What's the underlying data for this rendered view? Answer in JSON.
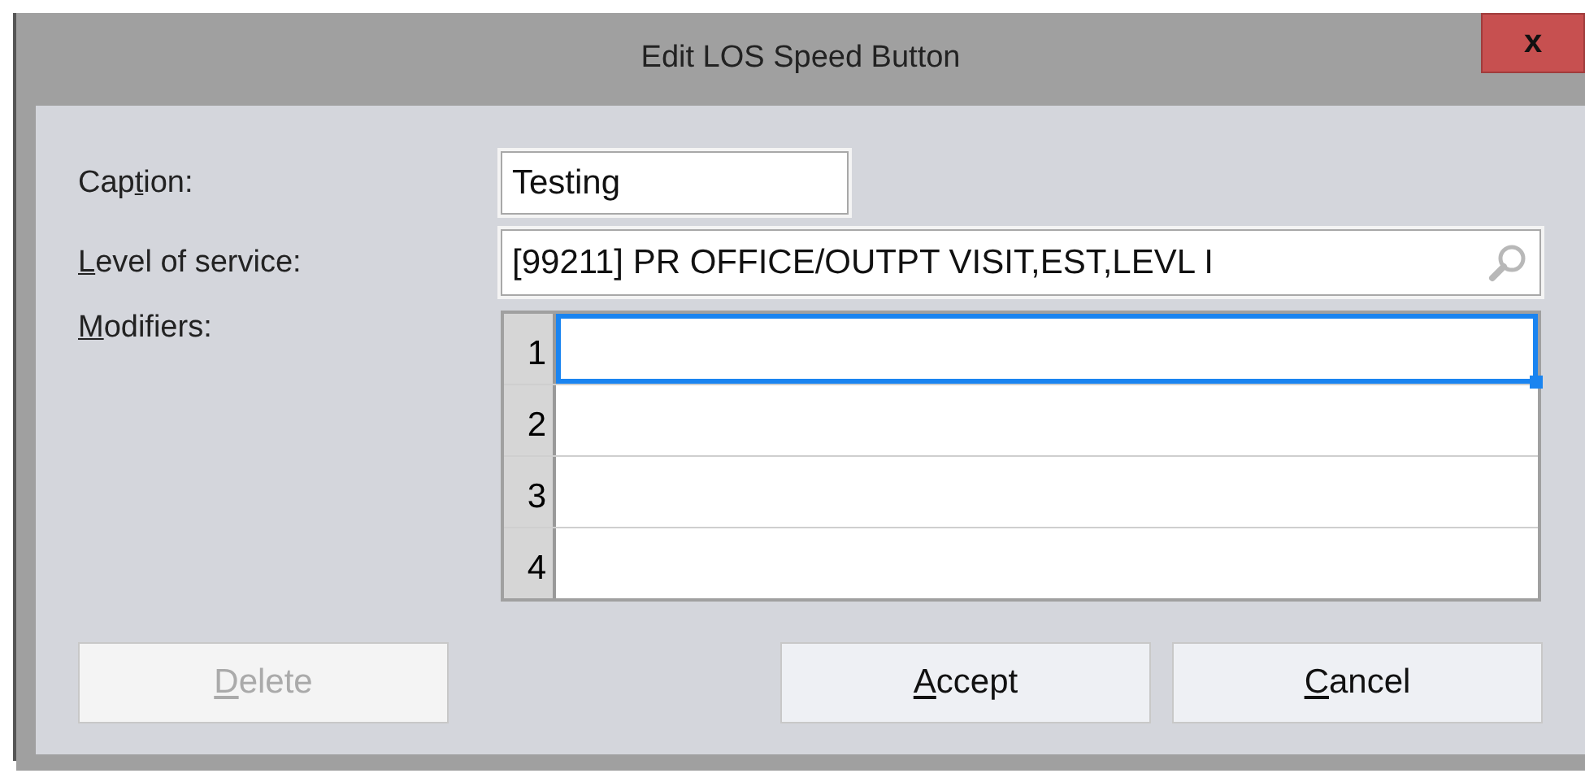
{
  "window": {
    "title": "Edit LOS Speed Button",
    "close_label": "x"
  },
  "fields": [
    {
      "label": {
        "before": "Cap",
        "key": "t",
        "after": "ion:"
      },
      "kind": "text",
      "value": "Testing"
    },
    {
      "label": {
        "key": "L",
        "after": "evel of service:"
      },
      "kind": "lookup",
      "value": "[99211] PR OFFICE/OUTPT VISIT,EST,LEVL I"
    }
  ],
  "modifiers": {
    "label": {
      "key": "M",
      "after": "odifiers:"
    },
    "rows": [
      {
        "number": "1",
        "selected": true
      },
      {
        "number": "2",
        "selected": false
      },
      {
        "number": "3",
        "selected": false
      },
      {
        "number": "4",
        "selected": false
      }
    ]
  },
  "buttons": [
    {
      "label": {
        "key": "D",
        "after": "elete"
      },
      "disabled": true
    },
    {
      "label": {
        "key": "A",
        "after": "ccept"
      },
      "disabled": false
    },
    {
      "label": {
        "key": "C",
        "after": "ancel"
      },
      "disabled": false
    }
  ]
}
